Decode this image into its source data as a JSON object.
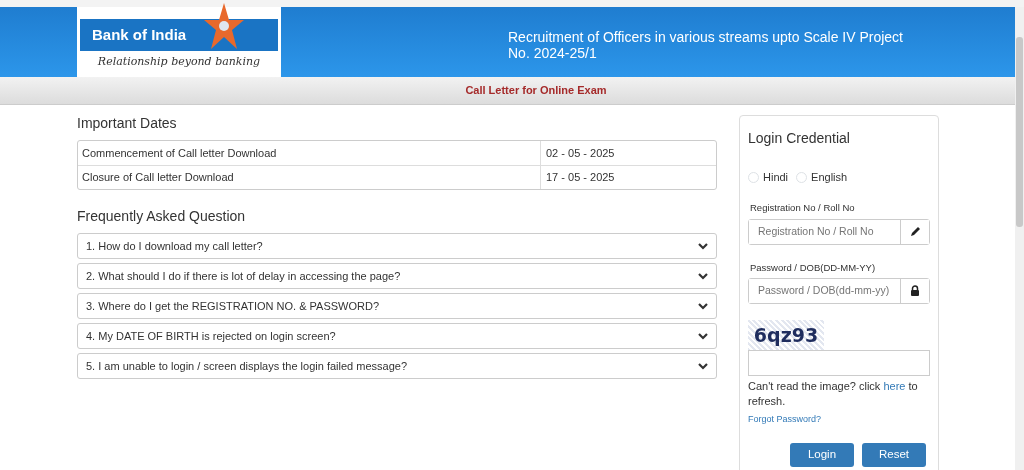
{
  "header": {
    "logo": {
      "name": "Bank of India",
      "tagline": "Relationship beyond banking"
    },
    "title": "Recruitment of Officers in various streams upto Scale IV Project No. 2024-25/1"
  },
  "subheader": "Call Letter for Online Exam",
  "dates": {
    "heading": "Important Dates",
    "rows": [
      {
        "label": "Commencement of Call letter Download",
        "date": "02 - 05 - 2025"
      },
      {
        "label": "Closure of Call letter Download",
        "date": "17 - 05 - 2025"
      }
    ]
  },
  "faq": {
    "heading": "Frequently Asked Question",
    "items": [
      {
        "question": "1. How do I download my call letter?",
        "expanded": false
      },
      {
        "question": "2. What should I do if there is lot of delay in accessing the page?",
        "expanded": false
      },
      {
        "question": "3. Where do I get the REGISTRATION NO. & PASSWORD?",
        "expanded": false
      },
      {
        "question": "4. My DATE OF BIRTH is rejected on login screen?",
        "expanded": false
      },
      {
        "question": "5. I am unable to login / screen displays the login failed message?",
        "expanded": false
      }
    ]
  },
  "login": {
    "heading": "Login Credential",
    "languages": [
      {
        "label": "Hindi",
        "selected": false
      },
      {
        "label": "English",
        "selected": false
      }
    ],
    "fields": [
      {
        "label": "Registration No / Roll No",
        "placeholder": "Registration No / Roll No",
        "kind": "text"
      },
      {
        "label": "Password / DOB(DD-MM-YY)",
        "placeholder": "Password / DOB(dd-mm-yy)",
        "kind": "password"
      }
    ],
    "captcha": "6qz93",
    "refresh_before": "Can't read the image? click ",
    "refresh_link": "here",
    "refresh_after": " to refresh.",
    "forgot": "Forgot Password?",
    "buttons": [
      "Login",
      "Reset"
    ]
  }
}
